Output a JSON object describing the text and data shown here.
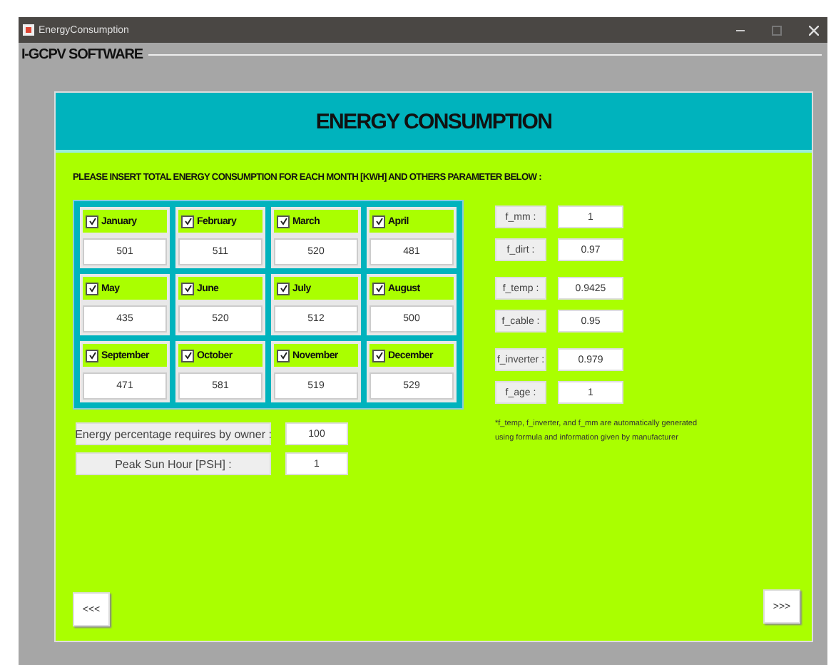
{
  "window": {
    "title": "EnergyConsumption"
  },
  "app_label": "I-GCPV SOFTWARE",
  "header": "ENERGY CONSUMPTION",
  "instruction": "PLEASE INSERT TOTAL ENERGY CONSUMPTION FOR EACH MONTH [KWH] AND OTHERS PARAMETER BELOW :",
  "months": [
    {
      "name": "January",
      "checked": true,
      "value": "501"
    },
    {
      "name": "February",
      "checked": true,
      "value": "511"
    },
    {
      "name": "March",
      "checked": true,
      "value": "520"
    },
    {
      "name": "April",
      "checked": true,
      "value": "481"
    },
    {
      "name": "May",
      "checked": true,
      "value": "435"
    },
    {
      "name": "June",
      "checked": true,
      "value": "520"
    },
    {
      "name": "July",
      "checked": true,
      "value": "512"
    },
    {
      "name": "August",
      "checked": true,
      "value": "500"
    },
    {
      "name": "September",
      "checked": true,
      "value": "471"
    },
    {
      "name": "October",
      "checked": true,
      "value": "581"
    },
    {
      "name": "November",
      "checked": true,
      "value": "519"
    },
    {
      "name": "December",
      "checked": true,
      "value": "529"
    }
  ],
  "energy_fields": [
    {
      "label": "Energy percentage requires by owner :",
      "value": "100"
    },
    {
      "label": "Peak Sun Hour [PSH] :",
      "value": "1"
    }
  ],
  "parameters": [
    {
      "label": "f_mm :",
      "value": "1"
    },
    {
      "label": "f_dirt :",
      "value": "0.97"
    },
    {
      "label": "f_temp :",
      "value": "0.9425"
    },
    {
      "label": "f_cable :",
      "value": "0.95"
    },
    {
      "label": "f_inverter :",
      "value": "0.979"
    },
    {
      "label": "f_age :",
      "value": "1"
    }
  ],
  "note": "*f_temp, f_inverter, and f_mm are automatically generated using formula and information given by manufacturer",
  "buttons": {
    "back": "<<<",
    "next": ">>>"
  }
}
